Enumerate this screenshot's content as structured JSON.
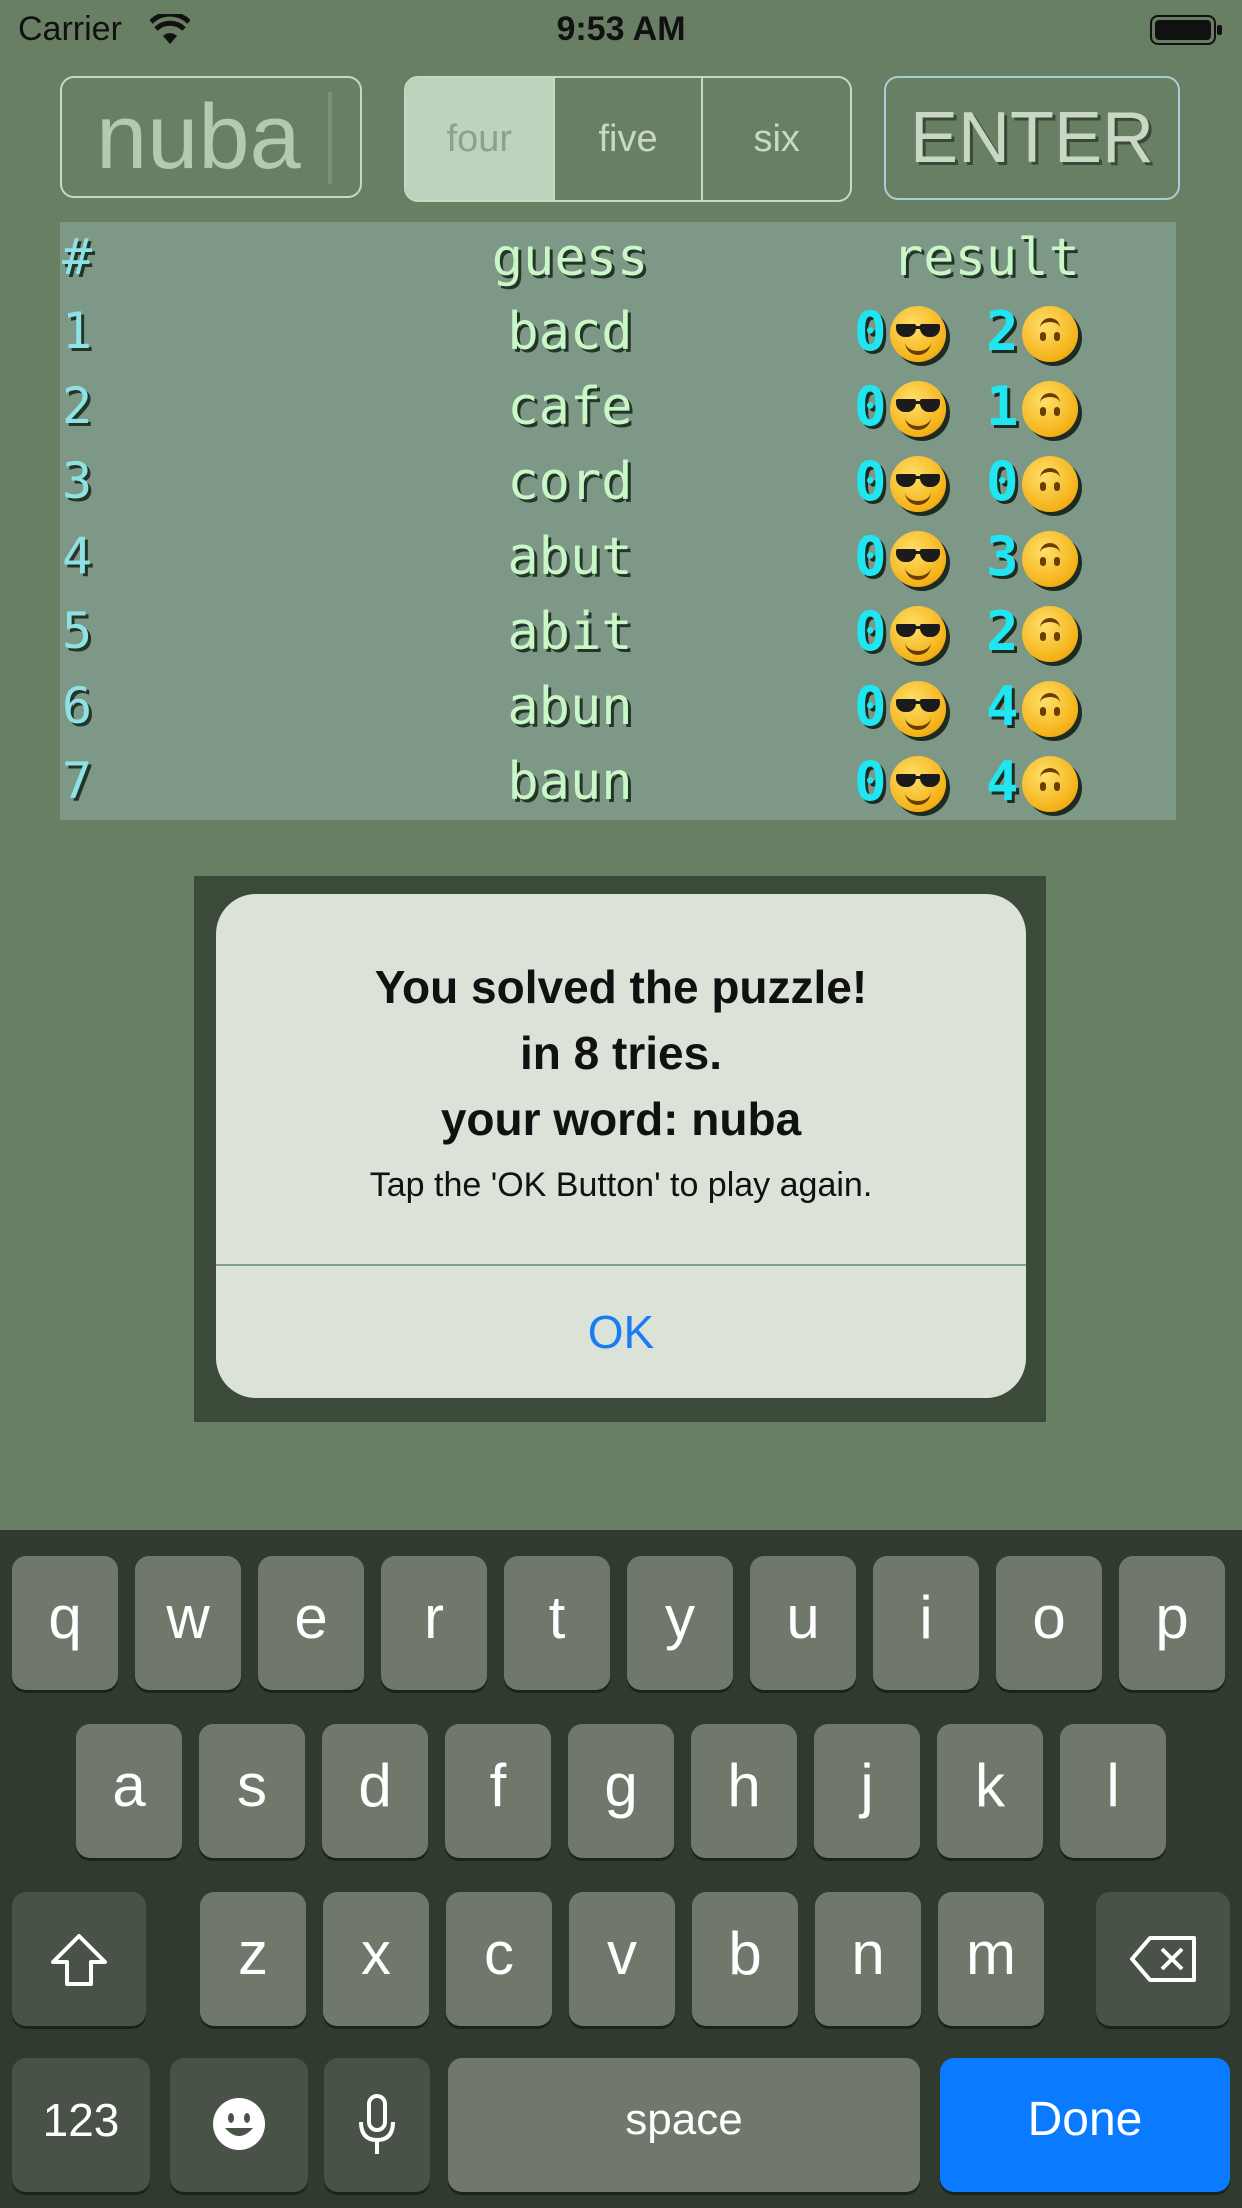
{
  "status": {
    "carrier": "Carrier",
    "time": "9:53 AM"
  },
  "input": {
    "value": "nuba"
  },
  "segments": [
    "four",
    "five",
    "six"
  ],
  "enter_label": "ENTER",
  "table": {
    "headers": {
      "num": "#",
      "guess": "guess",
      "result": "result"
    },
    "rows": [
      {
        "num": "1",
        "guess": "bacd",
        "exact": "0",
        "partial": "2"
      },
      {
        "num": "2",
        "guess": "cafe",
        "exact": "0",
        "partial": "1"
      },
      {
        "num": "3",
        "guess": "cord",
        "exact": "0",
        "partial": "0"
      },
      {
        "num": "4",
        "guess": "abut",
        "exact": "0",
        "partial": "3"
      },
      {
        "num": "5",
        "guess": "abit",
        "exact": "0",
        "partial": "2"
      },
      {
        "num": "6",
        "guess": "abun",
        "exact": "0",
        "partial": "4"
      },
      {
        "num": "7",
        "guess": "baun",
        "exact": "0",
        "partial": "4"
      }
    ],
    "icons": {
      "exact": "sunglasses-emoji-icon",
      "partial": "upside-down-face-emoji-icon"
    }
  },
  "alert": {
    "line1": "You solved the puzzle!",
    "line2": "in 8 tries.",
    "line3": "your word: nuba",
    "message": "Tap the 'OK Button' to play again.",
    "ok": "OK"
  },
  "keyboard": {
    "row1": [
      "q",
      "w",
      "e",
      "r",
      "t",
      "y",
      "u",
      "i",
      "o",
      "p"
    ],
    "row2": [
      "a",
      "s",
      "d",
      "f",
      "g",
      "h",
      "j",
      "k",
      "l"
    ],
    "row3": [
      "z",
      "x",
      "c",
      "v",
      "b",
      "n",
      "m"
    ],
    "numbers": "123",
    "space": "space",
    "done": "Done"
  },
  "colors": {
    "background": "#687f63",
    "accent": "#0a7bff",
    "digit": "#1fe6f0"
  }
}
